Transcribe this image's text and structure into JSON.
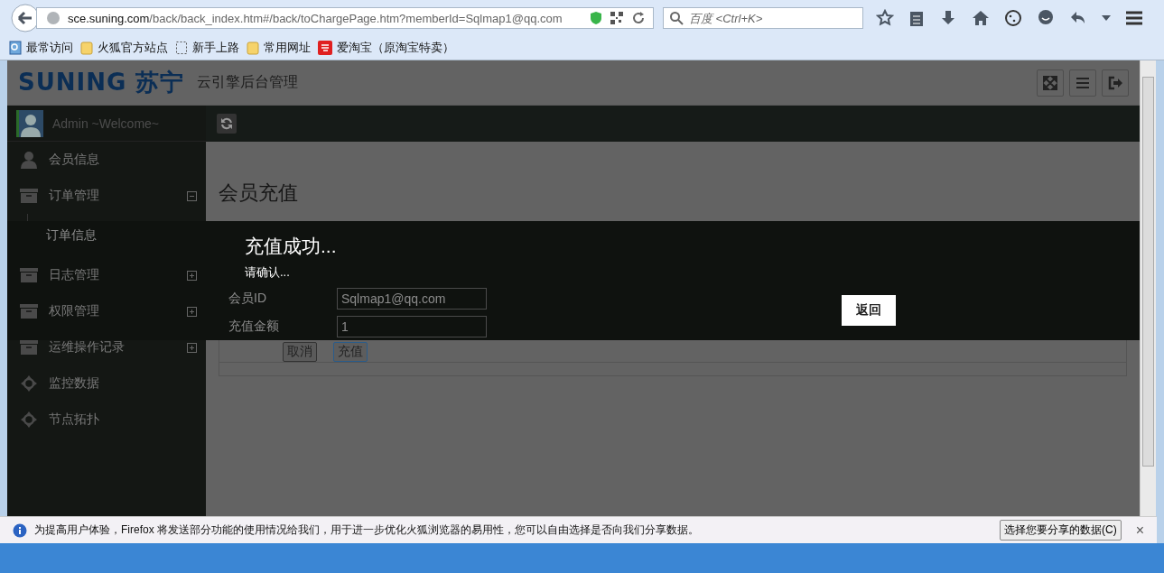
{
  "browser": {
    "url_host": "sce.suning.com",
    "url_path": "/back/back_index.htm#/back/toChargePage.htm?memberId=Sqlmap1@qq.com",
    "search": {
      "placeholder": "百度 <Ctrl+K>"
    },
    "bookmarks": [
      {
        "label": "最常访问",
        "kind": "smart"
      },
      {
        "label": "火狐官方站点",
        "kind": "folder"
      },
      {
        "label": "新手上路",
        "kind": "page"
      },
      {
        "label": "常用网址",
        "kind": "folder"
      },
      {
        "label": "爱淘宝（原淘宝特卖）",
        "kind": "taobao"
      }
    ]
  },
  "header": {
    "logo": "SUNING 苏宁",
    "title": "云引擎后台管理"
  },
  "sidebar": {
    "user": "Admin ~Welcome~",
    "items": [
      {
        "label": "会员信息",
        "kind": "person"
      },
      {
        "label": "订单管理",
        "kind": "group",
        "expanded": true,
        "children": [
          {
            "label": "订单信息"
          }
        ]
      },
      {
        "label": "日志管理",
        "kind": "group",
        "expanded": false
      },
      {
        "label": "权限管理",
        "kind": "group",
        "expanded": false
      },
      {
        "label": "运维操作记录",
        "kind": "group",
        "expanded": false
      },
      {
        "label": "监控数据",
        "kind": "tool"
      },
      {
        "label": "节点拓扑",
        "kind": "tool"
      }
    ]
  },
  "content": {
    "title": "会员充值",
    "form": {
      "fields": [
        {
          "label": "会员ID",
          "value": "Sqlmap1@qq.com"
        },
        {
          "label": "充值金额",
          "value": "1"
        }
      ],
      "buttons": [
        {
          "label": "取消",
          "primary": false
        },
        {
          "label": "充值",
          "primary": true
        }
      ]
    }
  },
  "dialog": {
    "title": "充值成功...",
    "message": "请确认...",
    "button": "返回"
  },
  "notification": {
    "text": "为提高用户体验，Firefox 将发送部分功能的使用情况给我们，用于进一步优化火狐浏览器的易用性，您可以自由选择是否向我们分享数据。",
    "button": "选择您要分享的数据(C)",
    "close": "×"
  }
}
